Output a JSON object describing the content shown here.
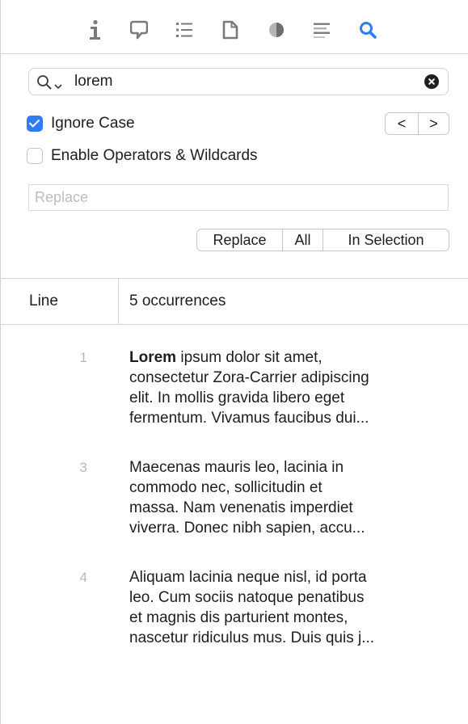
{
  "toolbar": {
    "icons": [
      "info-icon",
      "comment-icon",
      "list-icon",
      "document-icon",
      "circle-icon",
      "text-lines-icon",
      "search-icon"
    ],
    "active_icon": "search-icon",
    "accent_color": "#2f7cf6"
  },
  "search": {
    "value": "lorem",
    "ignore_case_label": "Ignore Case",
    "ignore_case_checked": true,
    "operators_label": "Enable Operators & Wildcards",
    "operators_checked": false,
    "prev_label": "<",
    "next_label": ">"
  },
  "replace": {
    "placeholder": "Replace",
    "replace_label": "Replace",
    "all_label": "All",
    "in_selection_label": "In Selection"
  },
  "results": {
    "col_line": "Line",
    "col_count": "5 occurrences",
    "rows": [
      {
        "line": "1",
        "match": "Lorem",
        "lines": [
          " ipsum dolor sit amet,",
          "consectetur Zora-Carrier adipiscing",
          "elit. In mollis gravida libero eget",
          "fermentum. Vivamus faucibus dui..."
        ]
      },
      {
        "line": "3",
        "lines": [
          "Maecenas mauris leo, lacinia in",
          "commodo nec, sollicitudin et",
          "massa. Nam venenatis imperdiet",
          "viverra. Donec nibh sapien, accu..."
        ]
      },
      {
        "line": "4",
        "lines": [
          "Aliquam lacinia neque nisl, id porta",
          "leo. Cum sociis natoque penatibus",
          "et magnis dis parturient montes,",
          "nascetur ridiculus mus. Duis quis j..."
        ]
      }
    ]
  }
}
